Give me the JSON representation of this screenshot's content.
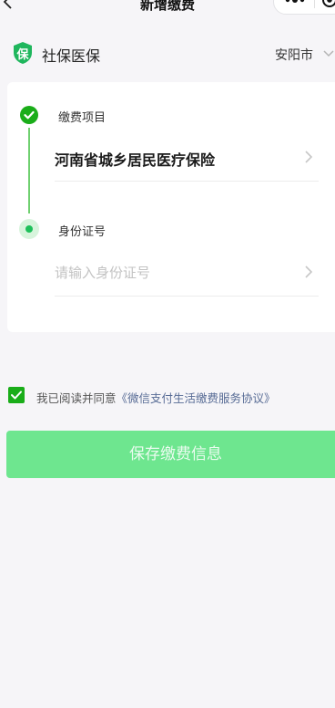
{
  "nav": {
    "title": "新增缴费"
  },
  "header": {
    "app_name": "社保医保",
    "logo_char": "保",
    "city": "安阳市"
  },
  "form": {
    "step1_label": "缴费项目",
    "step1_value": "河南省城乡居民医疗保险",
    "step2_label": "身份证号",
    "id_placeholder": "请输入身份证号",
    "id_value": ""
  },
  "agreement": {
    "checked": true,
    "prefix": "我已阅读并同意",
    "link": "《微信支付生活缴费服务协议》"
  },
  "actions": {
    "save_label": "保存缴费信息"
  },
  "colors": {
    "brand_green": "#1aad19",
    "button_disabled_green": "#6ee68f",
    "link_blue": "#576b95",
    "background": "#f6f5f8"
  },
  "icons": {
    "back": "chevron-left-icon",
    "more": "more-dots-icon",
    "close_target": "target-icon",
    "logo": "shield-logo-icon",
    "city_dropdown": "chevron-down-icon",
    "step_done": "check-circle-icon",
    "step_current": "dot-icon",
    "row_arrow": "chevron-right-icon",
    "agree": "checkbox-checked-icon"
  }
}
